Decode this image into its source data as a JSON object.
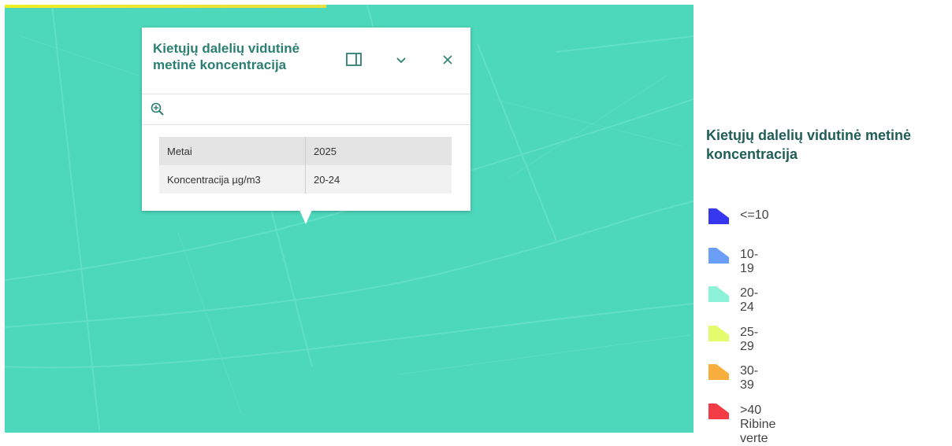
{
  "popup": {
    "title": "Kietųjų dalelių vidutinė metinė koncentracija",
    "dock_icon": "dock-panel-icon",
    "collapse_icon": "chevron-down-icon",
    "close_icon": "close-icon",
    "zoom_icon": "zoom-to-icon",
    "attributes": [
      {
        "key": "Metai",
        "value": "2025"
      },
      {
        "key": "Koncentracija µg/m3",
        "value": "20-24"
      }
    ]
  },
  "legend": {
    "title": "Kietųjų dalelių vidutinė metinė koncentracija",
    "items": [
      {
        "label": "<=10",
        "color": "#3737f0"
      },
      {
        "label": "10-19",
        "color": "#6b9ef6"
      },
      {
        "label": "20-24",
        "color": "#8cf3d9"
      },
      {
        "label": "25-29",
        "color": "#e3fb6c"
      },
      {
        "label": "30-39",
        "color": "#f8ae3c"
      },
      {
        "label": ">40 Ribine verte",
        "color": "#f23b45"
      }
    ]
  },
  "map": {
    "fill_color": "#4dd7bb",
    "loading_bar_color": "#f3ec28"
  }
}
